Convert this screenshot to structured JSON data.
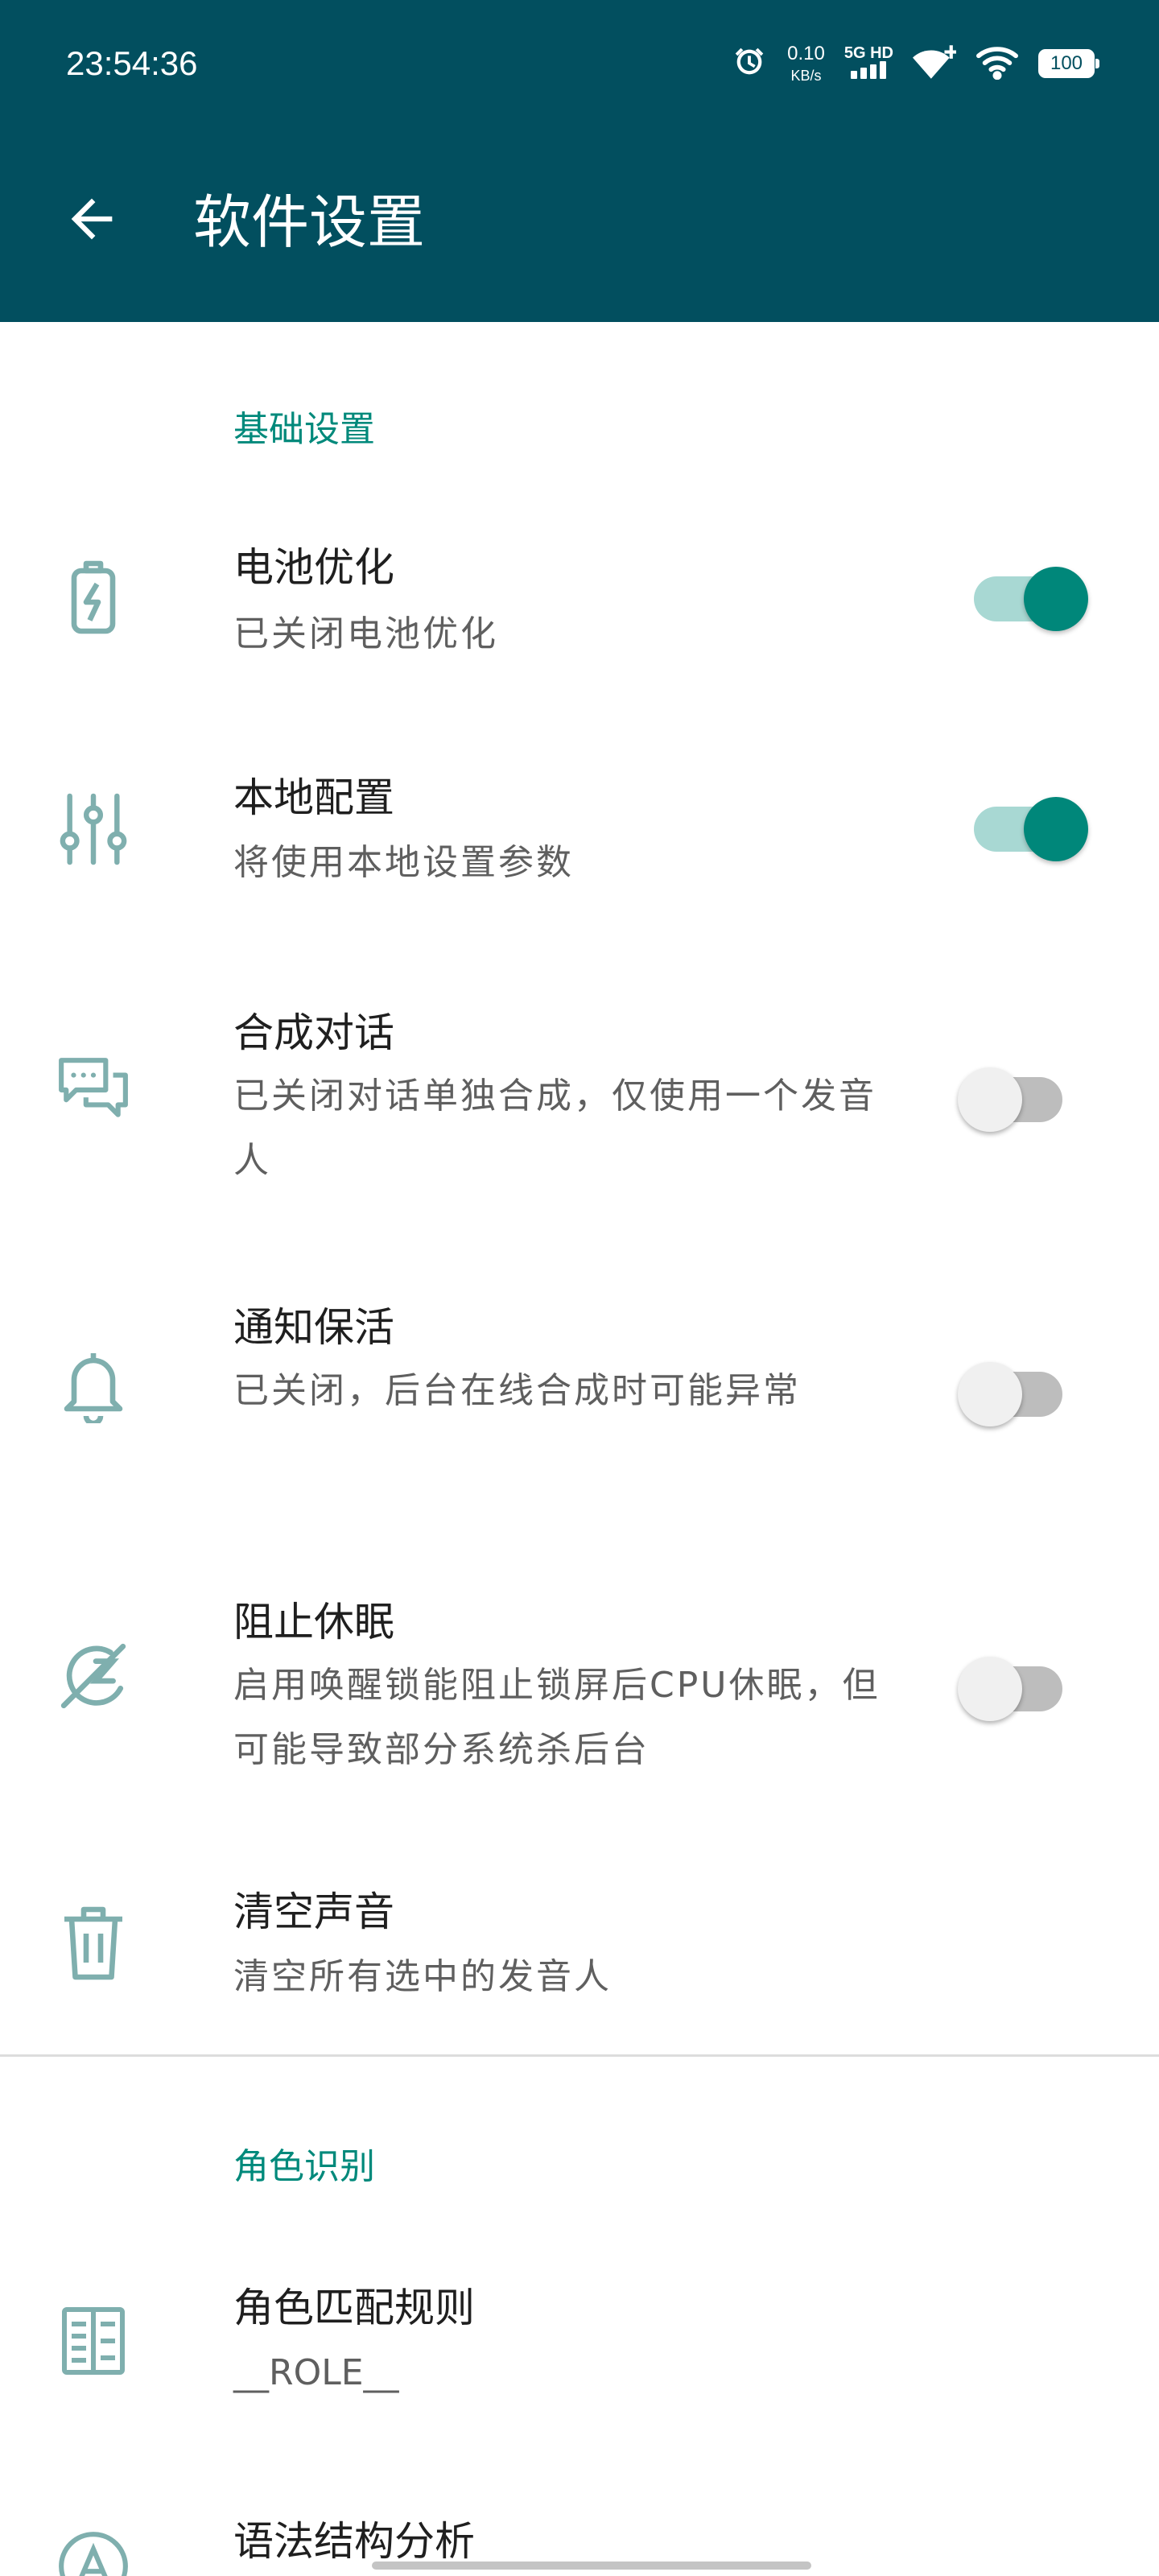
{
  "status_bar": {
    "time": "23:54:36",
    "net_speed_value": "0.10",
    "net_speed_unit": "KB/s",
    "network_type": "5G HD",
    "battery": "100",
    "icons": [
      "alarm-icon",
      "signal-icon",
      "wifi-calling-icon",
      "wifi-icon",
      "battery-icon"
    ]
  },
  "app_bar": {
    "title": "软件设置",
    "back_icon": "arrow-left-icon"
  },
  "sections": [
    {
      "header": "基础设置",
      "items": [
        {
          "title": "电池优化",
          "summary": "已关闭电池优化",
          "icon": "battery-charging-icon",
          "switch": "on"
        },
        {
          "title": "本地配置",
          "summary": "将使用本地设置参数",
          "icon": "tune-sliders-icon",
          "switch": "on"
        },
        {
          "title": "合成对话",
          "summary": "已关闭对话单独合成，仅使用一个发音人",
          "icon": "chat-bubbles-icon",
          "switch": "off"
        },
        {
          "title": "通知保活",
          "summary": "已关闭，后台在线合成时可能异常",
          "icon": "bell-icon",
          "switch": "off"
        },
        {
          "title": "阻止休眠",
          "summary": "启用唤醒锁能阻止锁屏后CPU休眠，但可能导致部分系统杀后台",
          "icon": "sleep-off-icon",
          "switch": "off"
        },
        {
          "title": "清空声音",
          "summary": "清空所有选中的发音人",
          "icon": "trash-icon"
        }
      ]
    },
    {
      "header": "角色识别",
      "items": [
        {
          "title": "角色匹配规则",
          "summary": "__ROLE__",
          "icon": "rules-book-icon"
        },
        {
          "title": "语法结构分析",
          "icon": "text-analysis-icon"
        }
      ]
    }
  ],
  "colors": {
    "app_bar": "#024F5F",
    "accent": "#00897B",
    "icon": "#7FAFAE"
  }
}
